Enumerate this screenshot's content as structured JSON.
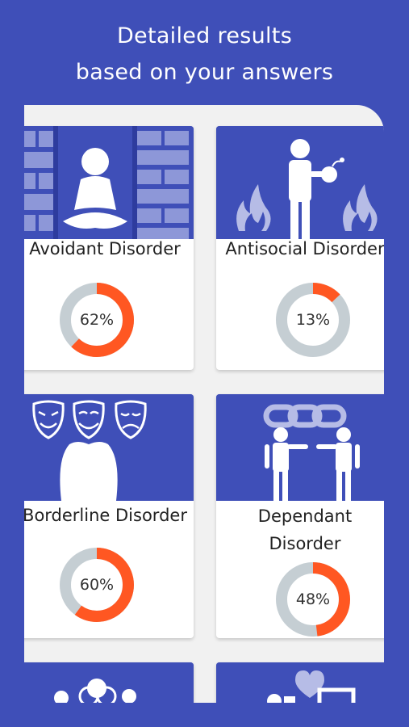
{
  "header": {
    "line1": "Detailed results",
    "line2": "based on your answers"
  },
  "colors": {
    "background": "#3f4fb8",
    "progress": "#ff5722",
    "track": "#c5ced3",
    "art_light": "#8d97d8"
  },
  "cards": [
    {
      "label": "Avoidant Disorder",
      "percent_text": "62%",
      "percent": 62,
      "icon": "person-meditating-between-walls-icon"
    },
    {
      "label": "Antisocial Disorder",
      "percent_text": "13%",
      "percent": 13,
      "icon": "person-with-bomb-and-fire-icon"
    },
    {
      "label": "Borderline Disorder",
      "percent_text": "60%",
      "percent": 60,
      "icon": "theater-masks-icon"
    },
    {
      "label": "Dependant Disorder",
      "percent_text": "48%",
      "percent": 48,
      "icon": "people-with-chain-icon"
    },
    {
      "icon": "group-of-people-icon"
    },
    {
      "icon": "heart-and-picture-icon"
    }
  ]
}
